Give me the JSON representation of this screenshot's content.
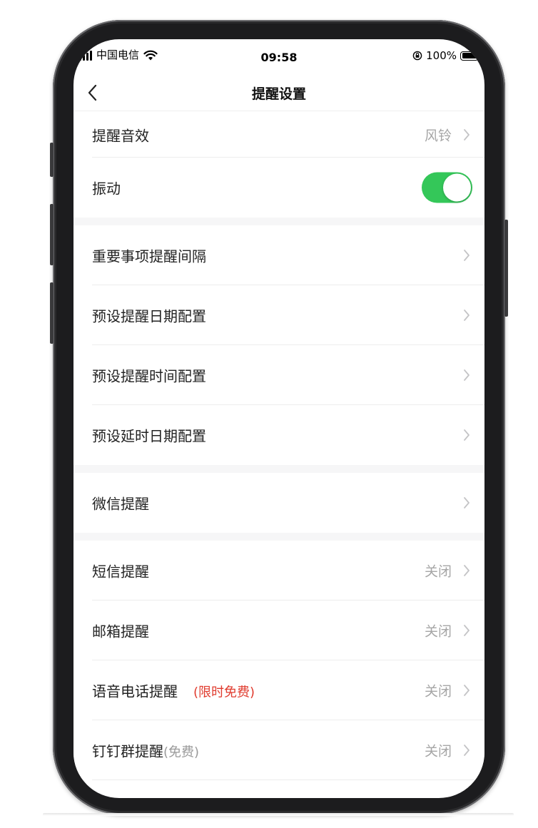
{
  "status_bar": {
    "carrier": "中国电信",
    "time": "09:58",
    "battery_percent": "100%",
    "battery_level": 1.0,
    "icons": [
      "signal-icon",
      "wifi-icon",
      "rotation-lock-icon",
      "battery-icon"
    ]
  },
  "nav": {
    "title": "提醒设置",
    "back_icon": "chevron-left-icon"
  },
  "colors": {
    "toggle_on": "#34c759",
    "promo_red": "#e03c2f",
    "value_gray": "#a6a6a6",
    "section_gap": "#f6f6f7"
  },
  "settings": {
    "sound": {
      "label": "提醒音效",
      "value": "风铃"
    },
    "vibrate": {
      "label": "振动",
      "enabled": true
    },
    "interval": {
      "label": "重要事项提醒间隔"
    },
    "preset_date": {
      "label": "预设提醒日期配置"
    },
    "preset_time": {
      "label": "预设提醒时间配置"
    },
    "preset_delay": {
      "label": "预设延时日期配置"
    },
    "wechat": {
      "label": "微信提醒"
    },
    "sms": {
      "label": "短信提醒",
      "value": "关闭"
    },
    "email": {
      "label": "邮箱提醒",
      "value": "关闭"
    },
    "voice_call": {
      "label": "语音电话提醒",
      "note": "(限时免费)",
      "value": "关闭"
    },
    "dingtalk": {
      "label": "钉钉群提醒",
      "note": "(免费)",
      "value": "关闭"
    }
  }
}
